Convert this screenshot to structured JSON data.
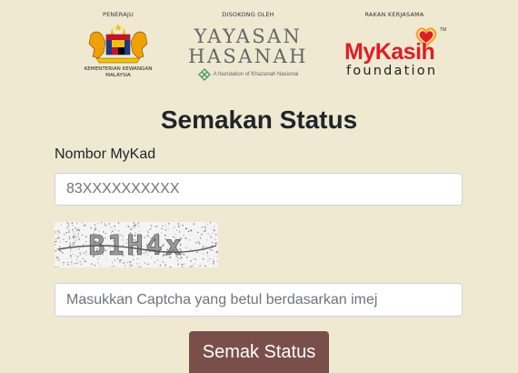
{
  "sponsors": {
    "peneraju": {
      "heading": "PENERAJU",
      "name_line1": "KEMENTERIAN KEWANGAN",
      "name_line2": "MALAYSIA",
      "logo_icon": "malaysia-coat-of-arms-icon"
    },
    "disokong": {
      "heading": "DISOKONG OLEH",
      "title_line1": "YAYASAN",
      "title_line2": "HASANAH",
      "tagline": "A foundation of Khazanah Nasional",
      "logo_icon": "hasanah-knot-icon",
      "color": "#666666",
      "tag_color": "#3a9a5b"
    },
    "rakan": {
      "heading": "RAKAN KERJASAMA",
      "brand": "MyKasih",
      "brand_sub": "foundation",
      "trademark": "TM",
      "logo_icon": "heart-icon",
      "brand_color": "#e31b23",
      "heart_color": "#f5a623"
    }
  },
  "form": {
    "title": "Semakan Status",
    "mykad_label": "Nombor MyKad",
    "mykad_placeholder": "83XXXXXXXXXX",
    "captcha_text": "B1H4x",
    "captcha_placeholder": "Masukkan Captcha yang betul berdasarkan imej",
    "submit_label": "Semak Status",
    "submit_color": "#7a4f4a"
  },
  "colors": {
    "page_background": "#efe9d2"
  }
}
